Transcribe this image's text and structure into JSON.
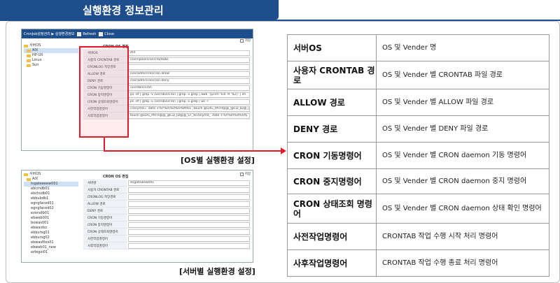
{
  "page": {
    "title": "실행환경 정보관리"
  },
  "shot1": {
    "breadcrumb": "CronJob설정관리 ▶ 실행환경정보",
    "refresh_label": "Refresh",
    "close_label": "Close",
    "save_label": "저장",
    "tree": [
      "서버OS",
      "AIX",
      "HP-UX",
      "Linux",
      "Sun"
    ],
    "form_title": "CRON OS 편집",
    "fields": [
      {
        "label": "서버OS",
        "value": "AIX"
      },
      {
        "label": "사용자 CRONTAB 경로",
        "value": "/var/spool/cron/crontabs"
      },
      {
        "label": "CRONLOG 저장경로",
        "value": ""
      },
      {
        "label": "ALLOW 경로",
        "value": "/var/adm/cron/cron.allow"
      },
      {
        "label": "DENY 경로",
        "value": "/var/adm/cron/cron.deny"
      },
      {
        "label": "CRON 기동명령어",
        "value": "/usr/sbin/cron"
      },
      {
        "label": "CRON 중지명령어",
        "value": "ps -ef | grep -v /usr/sbin/cron | grep -v grep | awk '{print \"kill -9 \"$2}' | sh"
      },
      {
        "label": "CRON 상태조회명령어",
        "value": "ps -ef | grep -v /usr/sbin/cron | grep -v grep | wc -l"
      },
      {
        "label": "사전작업명령어",
        "value": "cronymd=`date +%Y%m%d%H%M%S`;touch @LOG_PATH@@_@CD_ID@_@"
      },
      {
        "label": "사후작업명령어",
        "value": "touch @LOG_PATH@@_@CD_ID@@_ST_$cronymd_`date +%Y%m%d%H%"
      }
    ],
    "caption": "[OS별 실행환경 설정]"
  },
  "shot2": {
    "save_label": "저장",
    "tree": [
      "서버OS",
      "AIX",
      "tsgateeeew001",
      "ebcmdb01",
      "ebchsdb01",
      "ebbubdb1",
      "egngfaced01",
      "egngfaced02",
      "ezorsdb01",
      "ebweb001",
      "bowas001",
      "ebwaidsc",
      "ebbursg01",
      "ebbursg02",
      "ebwasfiles01",
      "ebweb01_new",
      "ezlegoi01"
    ],
    "form_title": "CRON OS 편집",
    "fields": [
      {
        "label": "서버명",
        "value": "itsgatewew001"
      },
      {
        "label": "사용자 CRONTAB 경로",
        "value": ""
      },
      {
        "label": "CRONLOG 저장경로",
        "value": ""
      },
      {
        "label": "ALLOW 경로",
        "value": ""
      },
      {
        "label": "DENY 경로",
        "value": ""
      },
      {
        "label": "CRON 기동명령어",
        "value": ""
      },
      {
        "label": "CRON 중지명령어",
        "value": ""
      },
      {
        "label": "CRON 상태조회명령어",
        "value": ""
      },
      {
        "label": "사전작업명령어",
        "value": ""
      },
      {
        "label": "사후작업명령어",
        "value": ""
      }
    ],
    "caption": "[서버별 실행환경 설정]"
  },
  "table": [
    {
      "key": "서버OS",
      "value": "OS 및 Vender 명"
    },
    {
      "key": "사용자 CRONTAB 경로",
      "value": "OS 및 Vender 별 CRONTAB 파일 경로"
    },
    {
      "key": "ALLOW 경로",
      "value": "OS 및 Vender 별 ALLOW 파일 경로"
    },
    {
      "key": "DENY 경로",
      "value": "OS 및 Vender 별 DENY 파일 경로"
    },
    {
      "key": "CRON 기동명령어",
      "value": "OS 및 Vender 별 CRON daemon 기동 명령어"
    },
    {
      "key": "CRON 중지명령어",
      "value": "OS 및 Vender 별 CRON daemon 중지 명령어"
    },
    {
      "key": "CRON 상태조회 명령어",
      "value": "OS 및 Vender 별 CRON daemon 상태 확인 명령어"
    },
    {
      "key": "사전작업명령어",
      "value": "CRONTAB 작업 수행 시작 처리 명령어"
    },
    {
      "key": "사후작업명령어",
      "value": "CRONTAB 작업 수행 종료 처리 명령어"
    }
  ],
  "colors": {
    "header": "#1f4e8c",
    "highlight": "#e01b2c"
  }
}
